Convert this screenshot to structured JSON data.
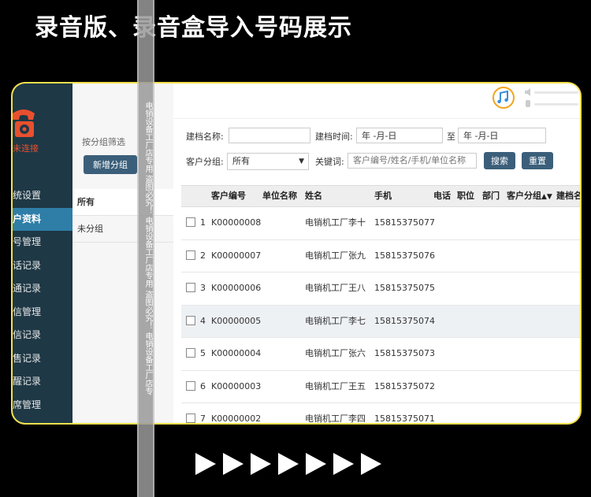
{
  "headline": "录音版、录音盒导入号码展示",
  "sidebar": {
    "status": "未连接",
    "items": [
      {
        "label": "统设置"
      },
      {
        "label": "户资料"
      },
      {
        "label": "号管理"
      },
      {
        "label": "话记录"
      },
      {
        "label": "通记录"
      },
      {
        "label": "信管理"
      },
      {
        "label": "信记录"
      },
      {
        "label": "售记录"
      },
      {
        "label": "醒记录"
      },
      {
        "label": "席管理"
      }
    ]
  },
  "groups": {
    "filter_label": "按分组筛选",
    "add_button": "新增分组",
    "items": [
      {
        "label": "所有"
      },
      {
        "label": "未分组"
      }
    ]
  },
  "watermark": "电销设备工厂店专用 盗图必究！ 电销设备工厂店专用 盗图必究！ 电销设备工厂店专",
  "filters": {
    "name_label": "建档名称:",
    "name_value": "",
    "time_label": "建档时间:",
    "date_from": "年 -月-日",
    "to_label": "至",
    "date_to": "年 -月-日",
    "group_label": "客户分组:",
    "group_value": "所有",
    "keyword_label": "关键词:",
    "keyword_placeholder": "客户编号/姓名/手机/单位名称",
    "search_button": "搜索",
    "reset_button": "重置"
  },
  "table": {
    "headers": [
      "客户编号",
      "单位名称",
      "姓名",
      "手机",
      "电话",
      "职位",
      "部门",
      "客户分组",
      "建档名"
    ],
    "rows": [
      {
        "no": "1",
        "id": "K00000008",
        "name": "电销机工厂李十",
        "mobile": "15815375077"
      },
      {
        "no": "2",
        "id": "K00000007",
        "name": "电销机工厂张九",
        "mobile": "15815375076"
      },
      {
        "no": "3",
        "id": "K00000006",
        "name": "电销机工厂王八",
        "mobile": "15815375075"
      },
      {
        "no": "4",
        "id": "K00000005",
        "name": "电销机工厂李七",
        "mobile": "15815375074"
      },
      {
        "no": "5",
        "id": "K00000004",
        "name": "电销机工厂张六",
        "mobile": "15815375073"
      },
      {
        "no": "6",
        "id": "K00000003",
        "name": "电销机工厂王五",
        "mobile": "15815375072"
      },
      {
        "no": "7",
        "id": "K00000002",
        "name": "电销机工厂李四",
        "mobile": "15815375071"
      }
    ]
  },
  "colors": {
    "accent": "#3b5f7a",
    "sidebar": "#1e3846",
    "frame": "#f4e04d",
    "status": "#e8502f"
  }
}
